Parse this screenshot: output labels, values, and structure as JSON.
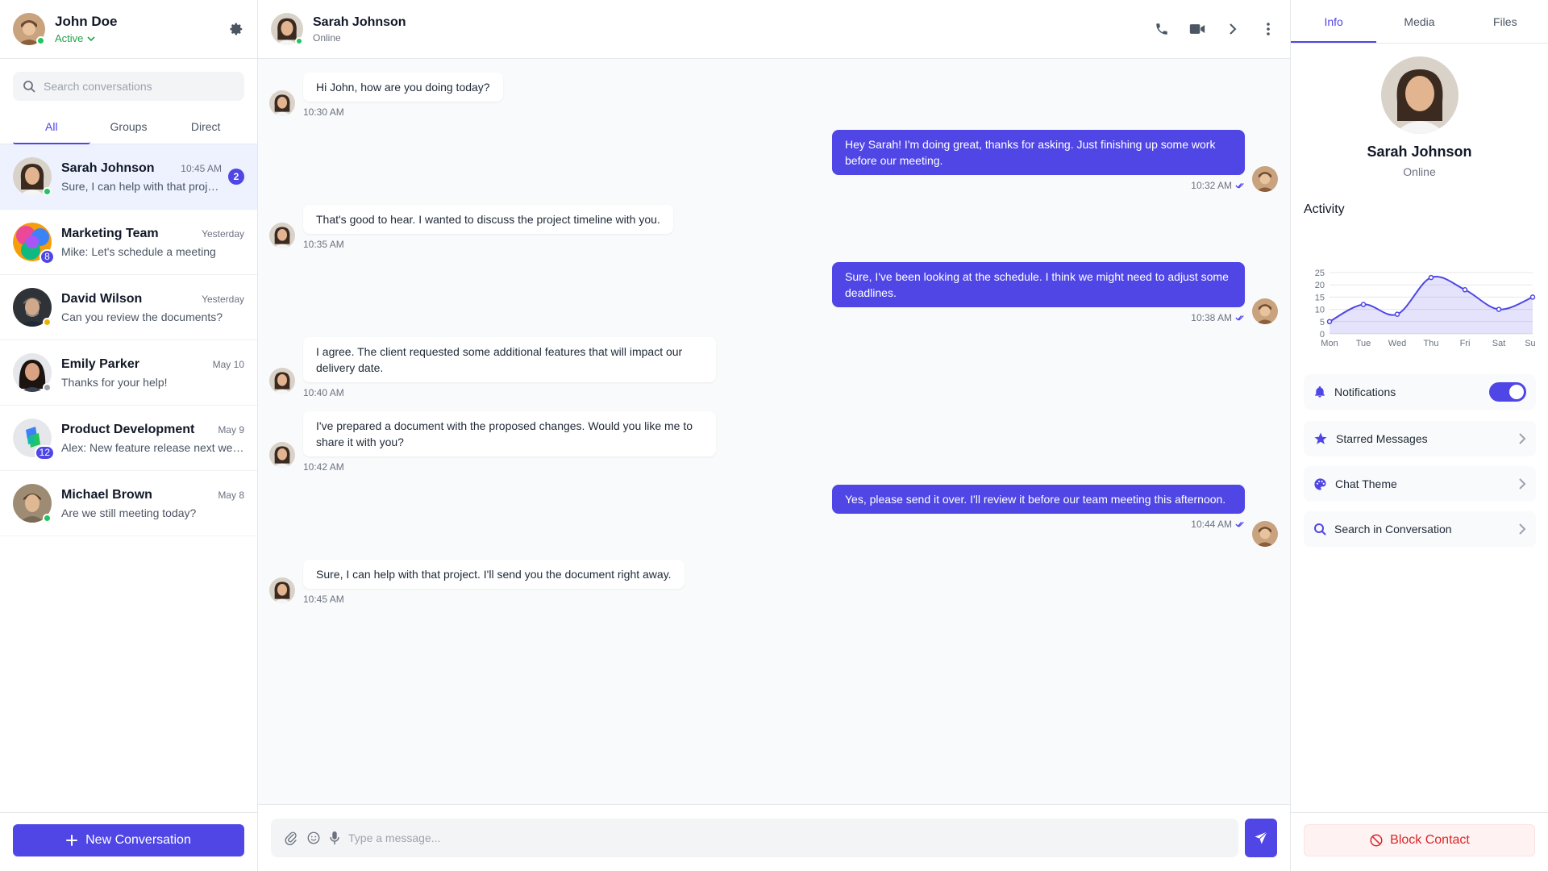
{
  "colors": {
    "accent": "#4f46e5",
    "online": "#22c55e",
    "away": "#eab308",
    "offline": "#9ca3af",
    "danger": "#dc2626"
  },
  "me": {
    "name": "John Doe",
    "status": "Active"
  },
  "search": {
    "placeholder": "Search conversations"
  },
  "tabs": [
    {
      "label": "All"
    },
    {
      "label": "Groups"
    },
    {
      "label": "Direct"
    }
  ],
  "conversations": [
    {
      "name": "Sarah Johnson",
      "time": "10:45 AM",
      "preview": "Sure, I can help with that project. I'll send you the document right away.",
      "unread": "2",
      "status": "online"
    },
    {
      "name": "Marketing Team",
      "time": "Yesterday",
      "preview": "Mike: Let's schedule a meeting",
      "members": "8"
    },
    {
      "name": "David Wilson",
      "time": "Yesterday",
      "preview": "Can you review the documents?",
      "status": "away"
    },
    {
      "name": "Emily Parker",
      "time": "May 10",
      "preview": "Thanks for your help!",
      "status": "offline"
    },
    {
      "name": "Product Development",
      "time": "May 9",
      "preview": "Alex: New feature release next week",
      "members": "12"
    },
    {
      "name": "Michael Brown",
      "time": "May 8",
      "preview": "Are we still meeting today?",
      "status": "online"
    }
  ],
  "new_conversation_label": "New Conversation",
  "chat": {
    "name": "Sarah Johnson",
    "status": "Online",
    "messages": [
      {
        "dir": "in",
        "text": "Hi John, how are you doing today?",
        "time": "10:30 AM"
      },
      {
        "dir": "out",
        "text": "Hey Sarah! I'm doing great, thanks for asking. Just finishing up some work before our meeting.",
        "time": "10:32 AM"
      },
      {
        "dir": "in",
        "text": "That's good to hear. I wanted to discuss the project timeline with you.",
        "time": "10:35 AM"
      },
      {
        "dir": "out",
        "text": "Sure, I've been looking at the schedule. I think we might need to adjust some deadlines.",
        "time": "10:38 AM"
      },
      {
        "dir": "in",
        "text": "I agree. The client requested some additional features that will impact our delivery date.",
        "time": "10:40 AM"
      },
      {
        "dir": "in",
        "text": "I've prepared a document with the proposed changes. Would you like me to share it with you?",
        "time": "10:42 AM"
      },
      {
        "dir": "out",
        "text": "Yes, please send it over. I'll review it before our team meeting this afternoon.",
        "time": "10:44 AM"
      },
      {
        "dir": "in",
        "text": "Sure, I can help with that project. I'll send you the document right away.",
        "time": "10:45 AM"
      }
    ],
    "composer_placeholder": "Type a message..."
  },
  "info": {
    "tabs": [
      {
        "label": "Info"
      },
      {
        "label": "Media"
      },
      {
        "label": "Files"
      }
    ],
    "name": "Sarah Johnson",
    "status": "Online",
    "activity_title": "Activity",
    "options": [
      {
        "label": "Notifications",
        "icon": "bell-icon",
        "control": "toggle",
        "on": true
      },
      {
        "label": "Starred Messages",
        "icon": "star-icon",
        "control": "chevron"
      },
      {
        "label": "Chat Theme",
        "icon": "palette-icon",
        "control": "chevron"
      },
      {
        "label": "Search in Conversation",
        "icon": "search-icon",
        "control": "chevron"
      }
    ],
    "block_label": "Block Contact"
  },
  "chart_data": {
    "type": "area",
    "title": "Activity",
    "categories": [
      "Mon",
      "Tue",
      "Wed",
      "Thu",
      "Fri",
      "Sat",
      "Sun"
    ],
    "values": [
      5,
      12,
      8,
      23,
      18,
      10,
      15
    ],
    "yticks": [
      0,
      5,
      10,
      15,
      20,
      25
    ],
    "ylim": [
      0,
      25
    ],
    "grid": true,
    "legend": "none"
  }
}
